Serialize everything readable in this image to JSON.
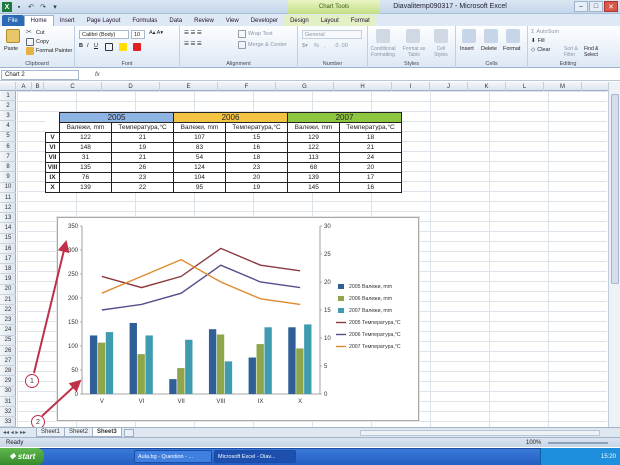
{
  "window": {
    "title": "Diavalitemp090317  -  Microsoft Excel",
    "chart_tools": "Chart Tools"
  },
  "ribbon_tabs": [
    "File",
    "Home",
    "Insert",
    "Page Layout",
    "Formulas",
    "Data",
    "Review",
    "View",
    "Developer",
    "Design",
    "Layout",
    "Format"
  ],
  "ribbon": {
    "clipboard": {
      "paste": "Paste",
      "cut": "Cut",
      "copy": "Copy",
      "format_painter": "Format Painter",
      "label": "Clipboard"
    },
    "font": {
      "name": "Calibri (Body)",
      "size": "10",
      "label": "Font",
      "bold": "B",
      "italic": "I",
      "underline": "U"
    },
    "alignment": {
      "wrap": "Wrap Text",
      "merge": "Merge & Center",
      "label": "Alignment"
    },
    "number": {
      "format": "General",
      "label": "Number",
      "percent": "%",
      "comma": ","
    },
    "styles": {
      "conditional": "Conditional Formatting",
      "table": "Format as Table",
      "cell": "Cell Styles",
      "label": "Styles"
    },
    "cells": {
      "insert": "Insert",
      "delete": "Delete",
      "format": "Format",
      "label": "Cells"
    },
    "editing": {
      "autosum": "AutoSum",
      "fill": "Fill",
      "clear": "Clear",
      "sort": "Sort & Filter",
      "find": "Find & Select",
      "label": "Editing"
    }
  },
  "namebox": "Chart 2",
  "fx": "fx",
  "columns": [
    "A",
    "B",
    "C",
    "D",
    "E",
    "F",
    "G",
    "H",
    "I",
    "J",
    "K",
    "L",
    "M"
  ],
  "rows": [
    "1",
    "2",
    "3",
    "4",
    "5",
    "6",
    "7",
    "8",
    "9",
    "10",
    "11",
    "12",
    "13",
    "14",
    "15",
    "16",
    "17",
    "18",
    "19",
    "20",
    "21",
    "22",
    "23",
    "24",
    "25",
    "26",
    "27",
    "28",
    "29",
    "30",
    "31",
    "32",
    "33"
  ],
  "table": {
    "years": [
      "2005",
      "2006",
      "2007"
    ],
    "headers": [
      "Валежи, mm",
      "Температура,°C",
      "Валежи, mm",
      "Температура,°C",
      "Валежи, mm",
      "Температура,°C"
    ],
    "rows": [
      {
        "label": "V",
        "cells": [
          "122",
          "21",
          "107",
          "15",
          "129",
          "18"
        ]
      },
      {
        "label": "VI",
        "cells": [
          "148",
          "19",
          "83",
          "16",
          "122",
          "21"
        ]
      },
      {
        "label": "VII",
        "cells": [
          "31",
          "21",
          "54",
          "18",
          "113",
          "24"
        ]
      },
      {
        "label": "VIII",
        "cells": [
          "135",
          "26",
          "124",
          "23",
          "68",
          "20"
        ]
      },
      {
        "label": "IX",
        "cells": [
          "76",
          "23",
          "104",
          "20",
          "139",
          "17"
        ]
      },
      {
        "label": "X",
        "cells": [
          "139",
          "22",
          "95",
          "19",
          "145",
          "16"
        ]
      }
    ],
    "colors": {
      "y2005": "#8db4e2",
      "y2006": "#f5c342",
      "y2007": "#8dc63f"
    }
  },
  "chart_data": {
    "type": "bar",
    "categories": [
      "V",
      "VI",
      "VII",
      "VIII",
      "IX",
      "X"
    ],
    "series": [
      {
        "name": "2005 Валежи, mm",
        "type": "bar",
        "axis": "left",
        "color": "#2f5f96",
        "values": [
          122,
          148,
          31,
          135,
          76,
          139
        ]
      },
      {
        "name": "2006 Валежи, mm",
        "type": "bar",
        "axis": "left",
        "color": "#8ea54a",
        "values": [
          107,
          83,
          54,
          124,
          104,
          95
        ]
      },
      {
        "name": "2007 Валежи, mm",
        "type": "bar",
        "axis": "left",
        "color": "#3f9cb0",
        "values": [
          129,
          122,
          113,
          68,
          139,
          145
        ]
      },
      {
        "name": "2005 Температура,°C",
        "type": "line",
        "axis": "right",
        "color": "#8b3a3f",
        "values": [
          21,
          19,
          21,
          26,
          23,
          22
        ]
      },
      {
        "name": "2006 Температура,°C",
        "type": "line",
        "axis": "right",
        "color": "#5b4b8a",
        "values": [
          15,
          16,
          18,
          23,
          20,
          19
        ]
      },
      {
        "name": "2007 Температура,°C",
        "type": "line",
        "axis": "right",
        "color": "#e08a2e",
        "values": [
          18,
          21,
          24,
          20,
          17,
          16
        ]
      }
    ],
    "ylim": [
      0,
      350
    ],
    "y2lim": [
      0,
      30
    ],
    "yticks": [
      "0",
      "50",
      "100",
      "150",
      "200",
      "250",
      "300",
      "350"
    ],
    "y2ticks": [
      "0",
      "5",
      "10",
      "15",
      "20",
      "25",
      "30"
    ],
    "grid": false,
    "legend": "right"
  },
  "callouts": [
    "1",
    "2"
  ],
  "sheets": [
    "Sheet1",
    "Sheet2",
    "Sheet3"
  ],
  "status": {
    "ready": "Ready",
    "zoom": "100%"
  },
  "taskbar": {
    "start": "start",
    "items": [
      "Aula.bg - Question - ...",
      "Microsoft Excel - Diav..."
    ],
    "clock": "15:20"
  }
}
